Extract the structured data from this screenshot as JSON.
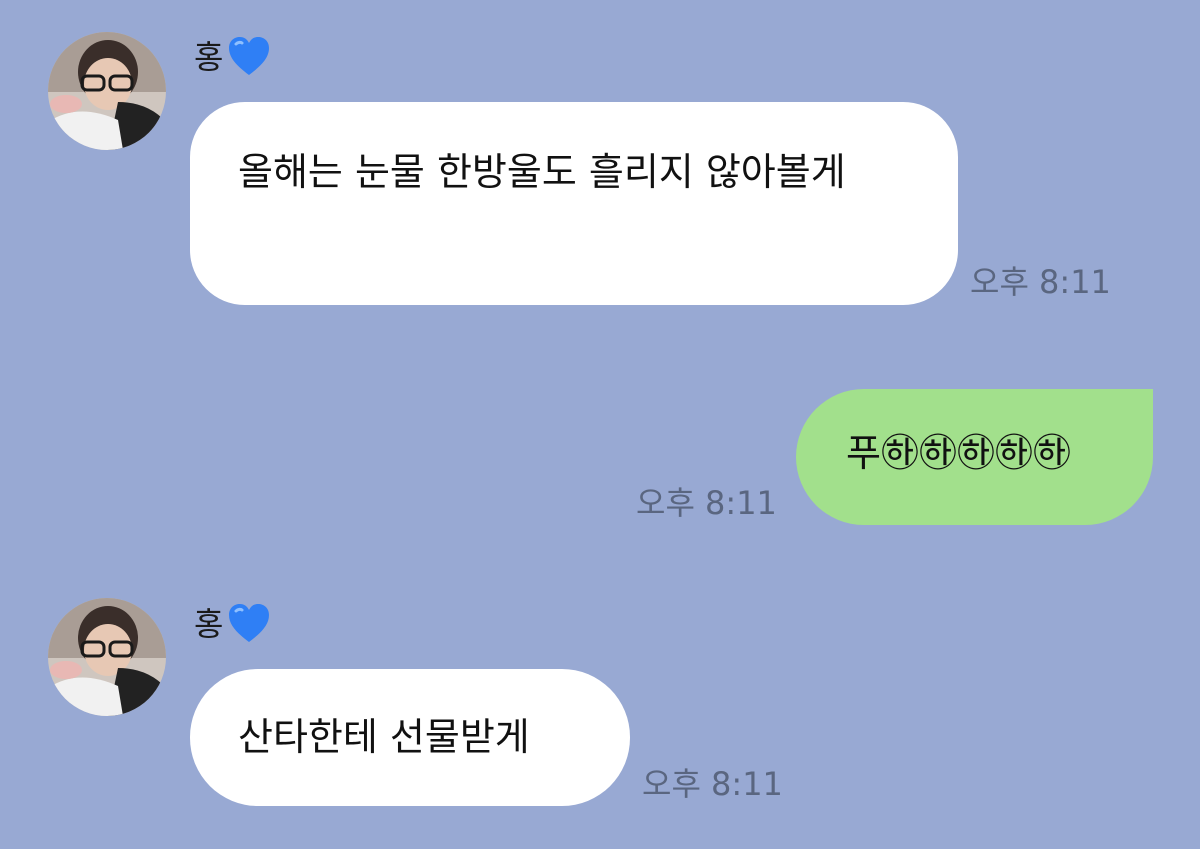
{
  "colors": {
    "background": "#98A9D3",
    "incoming_bubble": "#FFFFFF",
    "outgoing_bubble": "#A2E08C",
    "timestamp": "#5A6680",
    "heart": "#2F7FF5"
  },
  "messages": [
    {
      "sender": "홍",
      "sender_badge": "blue-heart-icon",
      "text": "올해는 눈물 한방울도 흘리지 않아볼게",
      "time": "오후 8:11"
    },
    {
      "sender": "me",
      "text": "푸㉻㉻㉻㉻㉻",
      "time": "오후 8:11"
    },
    {
      "sender": "홍",
      "sender_badge": "blue-heart-icon",
      "text": "산타한테 선물받게",
      "time": "오후 8:11"
    }
  ]
}
